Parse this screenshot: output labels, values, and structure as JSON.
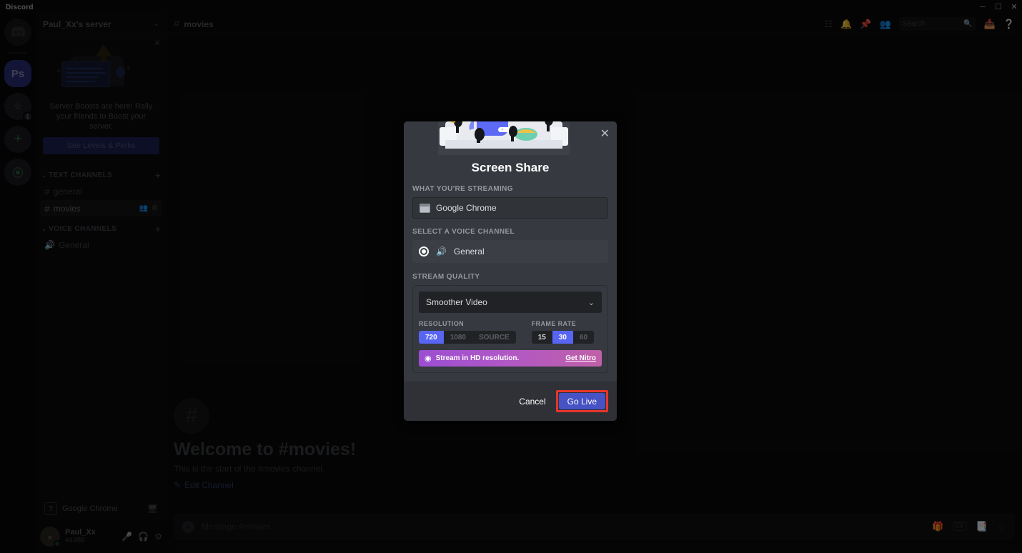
{
  "window": {
    "title": "Discord",
    "controls": {
      "minimize": "─",
      "maximize": "☐",
      "close": "✕"
    }
  },
  "server_rail": {
    "items": [
      {
        "name": "home",
        "label": "",
        "icon": "discord-logo-icon",
        "badge": ""
      },
      {
        "name": "photoshop-server",
        "label": "Ps",
        "icon": "server-avatar",
        "badge": ""
      },
      {
        "name": "second-server",
        "label": "⭐",
        "icon": "server-avatar",
        "badge": "1"
      },
      {
        "name": "add-server",
        "label": "+",
        "icon": "plus-icon",
        "badge": ""
      },
      {
        "name": "explore-servers",
        "label": "⦿",
        "icon": "compass-icon",
        "badge": ""
      }
    ]
  },
  "sidebar": {
    "server_name": "Paul_Xx's server",
    "chevron": "⌄",
    "boost": {
      "close": "✕",
      "text": "Server Boosts are here! Rally your friends to Boost your server.",
      "button_label": "See Levels & Perks"
    },
    "groups": [
      {
        "label": "TEXT CHANNELS",
        "caret": "⌄",
        "plus": "+",
        "channels": [
          {
            "name": "general",
            "prefix": "#",
            "active": false
          },
          {
            "name": "movies",
            "prefix": "#",
            "active": true
          }
        ]
      },
      {
        "label": "VOICE CHANNELS",
        "caret": "⌄",
        "plus": "+",
        "channels": [
          {
            "name": "General",
            "prefix": "🔊",
            "active": false
          }
        ]
      }
    ],
    "stream_panel": {
      "thumb_label": "?",
      "app_name": "Google Chrome",
      "screen_icon": "screen-share-icon"
    },
    "user": {
      "name": "Paul_Xx",
      "tag": "#4488",
      "mic_icon": "microphone-icon",
      "headphones_icon": "headphones-icon",
      "settings_icon": "gear-icon"
    }
  },
  "topbar": {
    "hash": "#",
    "channel": "movies",
    "icons": [
      "threads-icon",
      "bell-icon",
      "pin-icon",
      "members-icon"
    ],
    "search": {
      "placeholder": "Search",
      "icon": "search-icon"
    },
    "inbox_icon": "inbox-icon",
    "help_icon": "help-icon"
  },
  "chat": {
    "welcome_hash": "#",
    "welcome_title": "Welcome to #movies!",
    "welcome_sub": "This is the start of the #movies channel.",
    "edit_channel": "Edit Channel",
    "edit_icon": "pencil-icon",
    "composer": {
      "plus": "+",
      "placeholder": "Message #movies",
      "icons": [
        "gift-icon",
        "GIF",
        "sticker-icon",
        "emoji-icon"
      ]
    }
  },
  "modal": {
    "close": "✕",
    "title": "Screen Share",
    "streaming_label": "WHAT YOU'RE STREAMING",
    "streaming_value": "Google Chrome",
    "voice_label": "SELECT A VOICE CHANNEL",
    "voice_channel": "General",
    "speaker_icon": "speaker-icon",
    "quality_label": "STREAM QUALITY",
    "quality_value": "Smoother Video",
    "quality_chevron": "⌄",
    "resolution_label": "RESOLUTION",
    "resolution_options": [
      {
        "label": "720",
        "state": "on"
      },
      {
        "label": "1080",
        "state": "locked"
      },
      {
        "label": "SOURCE",
        "state": "locked"
      }
    ],
    "framerate_label": "FRAME RATE",
    "framerate_options": [
      {
        "label": "15",
        "state": "available"
      },
      {
        "label": "30",
        "state": "on"
      },
      {
        "label": "60",
        "state": "locked"
      }
    ],
    "nitro_text": "Stream in HD resolution.",
    "nitro_link": "Get Nitro",
    "nitro_icon": "nitro-wheel-icon",
    "cancel_label": "Cancel",
    "golive_label": "Go Live"
  },
  "colors": {
    "blurple": "#5865f2",
    "golive_button": "#4752c4",
    "highlight_red": "#e8352b",
    "modal_bg": "#36393f",
    "modal_footer_bg": "#2f3136"
  }
}
